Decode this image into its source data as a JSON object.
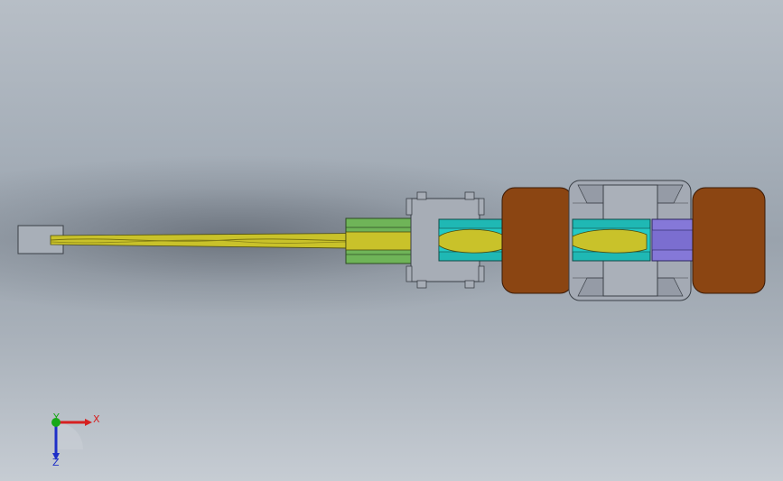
{
  "triad": {
    "x_label": "X",
    "y_label": "Y",
    "z_label": "Z",
    "x_color": "#d62020",
    "y_color": "#18a818",
    "z_color": "#1e2fc8"
  },
  "colors": {
    "rod_yellow": "#c9c22a",
    "green_block": "#6fb458",
    "teal_block": "#1fb8b4",
    "purple_block": "#8578d8",
    "brown_pad": "#8b4512",
    "gray_part": "#a9aeb8"
  }
}
